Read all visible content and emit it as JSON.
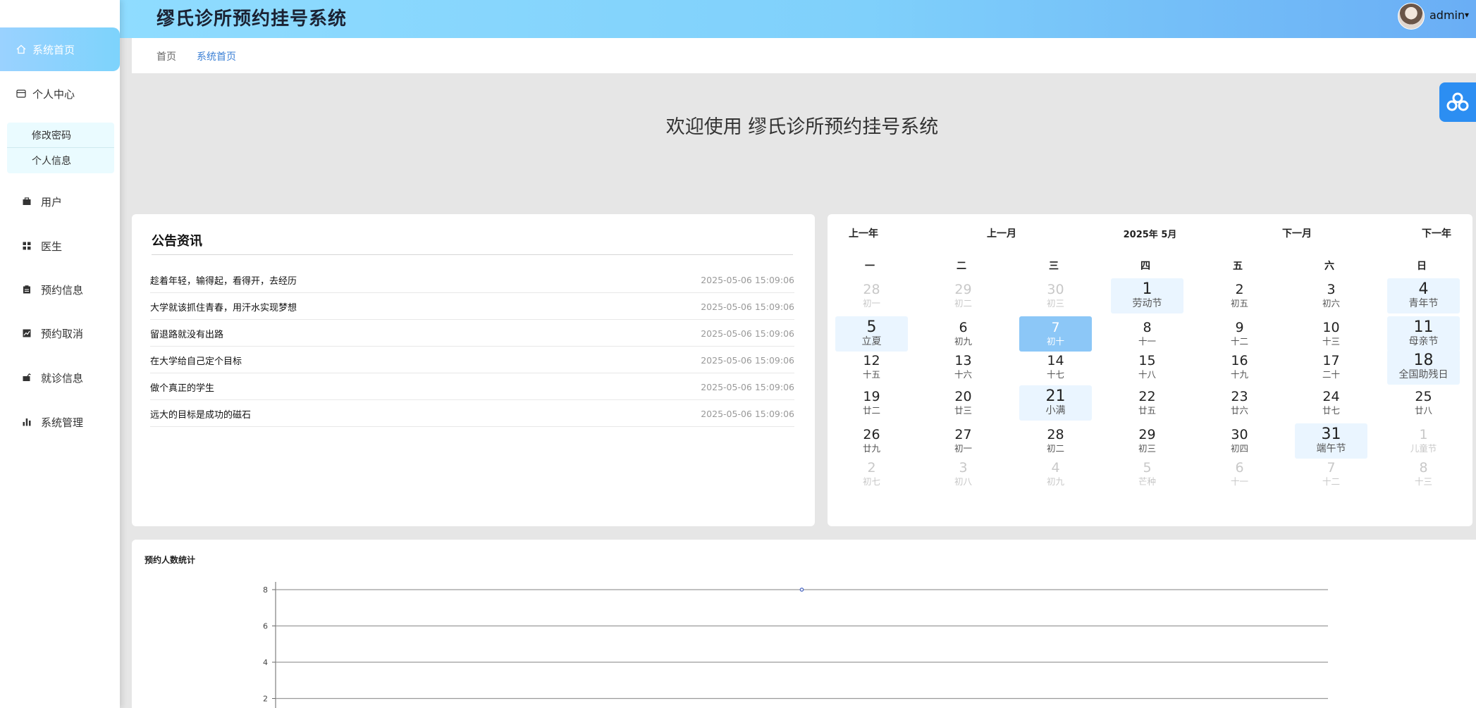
{
  "header": {
    "title": "缪氏诊所预约挂号系统",
    "username": "admin",
    "caret": "▾"
  },
  "sidebar": {
    "items": [
      {
        "label": "系统首页",
        "icon": "home-icon"
      },
      {
        "label": "个人中心",
        "icon": "card-icon"
      },
      {
        "label": "用户",
        "icon": "briefcase-icon"
      },
      {
        "label": "医生",
        "icon": "grid-icon"
      },
      {
        "label": "预约信息",
        "icon": "clipboard-icon"
      },
      {
        "label": "预约取消",
        "icon": "chart-square-icon"
      },
      {
        "label": "就诊信息",
        "icon": "cart-icon"
      },
      {
        "label": "系统管理",
        "icon": "bar-chart-icon"
      }
    ],
    "sub_items": [
      {
        "label": "修改密码"
      },
      {
        "label": "个人信息"
      }
    ]
  },
  "breadcrumb": {
    "home": "首页",
    "current": "系统首页"
  },
  "welcome": "欢迎使用 缪氏诊所预约挂号系统",
  "news": {
    "title": "公告资讯",
    "items": [
      {
        "title": "趁着年轻，输得起，看得开，去经历",
        "date": "2025-05-06 15:09:06"
      },
      {
        "title": "大学就该抓住青春，用汗水实现梦想",
        "date": "2025-05-06 15:09:06"
      },
      {
        "title": "留退路就没有出路",
        "date": "2025-05-06 15:09:06"
      },
      {
        "title": "在大学给自己定个目标",
        "date": "2025-05-06 15:09:06"
      },
      {
        "title": "做个真正的学生",
        "date": "2025-05-06 15:09:06"
      },
      {
        "title": "远大的目标是成功的磁石",
        "date": "2025-05-06 15:09:06"
      }
    ]
  },
  "calendar": {
    "prev_year": "上一年",
    "prev_month": "上一月",
    "title": "2025年 5月",
    "next_month": "下一月",
    "next_year": "下一年",
    "weekdays": [
      "一",
      "二",
      "三",
      "四",
      "五",
      "六",
      "日"
    ],
    "days": [
      {
        "n": "28",
        "l": "初一",
        "other": true
      },
      {
        "n": "29",
        "l": "初二",
        "other": true
      },
      {
        "n": "30",
        "l": "初三",
        "other": true
      },
      {
        "n": "1",
        "l": "劳动节",
        "hol": true
      },
      {
        "n": "2",
        "l": "初五"
      },
      {
        "n": "3",
        "l": "初六"
      },
      {
        "n": "4",
        "l": "青年节",
        "hol": true
      },
      {
        "n": "5",
        "l": "立夏",
        "hol": true
      },
      {
        "n": "6",
        "l": "初九"
      },
      {
        "n": "7",
        "l": "初十",
        "today": true
      },
      {
        "n": "8",
        "l": "十一"
      },
      {
        "n": "9",
        "l": "十二"
      },
      {
        "n": "10",
        "l": "十三"
      },
      {
        "n": "11",
        "l": "母亲节",
        "hol": true
      },
      {
        "n": "12",
        "l": "十五"
      },
      {
        "n": "13",
        "l": "十六"
      },
      {
        "n": "14",
        "l": "十七"
      },
      {
        "n": "15",
        "l": "十八"
      },
      {
        "n": "16",
        "l": "十九"
      },
      {
        "n": "17",
        "l": "二十"
      },
      {
        "n": "18",
        "l": "全国助残日",
        "hol": true
      },
      {
        "n": "19",
        "l": "廿二"
      },
      {
        "n": "20",
        "l": "廿三"
      },
      {
        "n": "21",
        "l": "小满",
        "hol": true
      },
      {
        "n": "22",
        "l": "廿五"
      },
      {
        "n": "23",
        "l": "廿六"
      },
      {
        "n": "24",
        "l": "廿七"
      },
      {
        "n": "25",
        "l": "廿八"
      },
      {
        "n": "26",
        "l": "廿九"
      },
      {
        "n": "27",
        "l": "初一"
      },
      {
        "n": "28",
        "l": "初二"
      },
      {
        "n": "29",
        "l": "初三"
      },
      {
        "n": "30",
        "l": "初四"
      },
      {
        "n": "31",
        "l": "端午节",
        "hol": true
      },
      {
        "n": "1",
        "l": "儿童节",
        "other": true
      },
      {
        "n": "2",
        "l": "初七",
        "other": true
      },
      {
        "n": "3",
        "l": "初八",
        "other": true
      },
      {
        "n": "4",
        "l": "初九",
        "other": true
      },
      {
        "n": "5",
        "l": "芒种",
        "other": true
      },
      {
        "n": "6",
        "l": "十一",
        "other": true
      },
      {
        "n": "7",
        "l": "十二",
        "other": true
      },
      {
        "n": "8",
        "l": "十三",
        "other": true
      }
    ]
  },
  "chart_data": {
    "type": "line",
    "title": "预约人数统计",
    "yticks": [
      2,
      4,
      6,
      8
    ],
    "ylim": [
      0,
      8
    ],
    "series": [
      {
        "points": [
          {
            "x": 0.5,
            "y": 8
          }
        ]
      }
    ]
  },
  "colors": {
    "accent": "#3a7fd5",
    "header_start": "#8fdcff",
    "header_end": "#6aaef5",
    "float_button": "#2c8ef2"
  }
}
